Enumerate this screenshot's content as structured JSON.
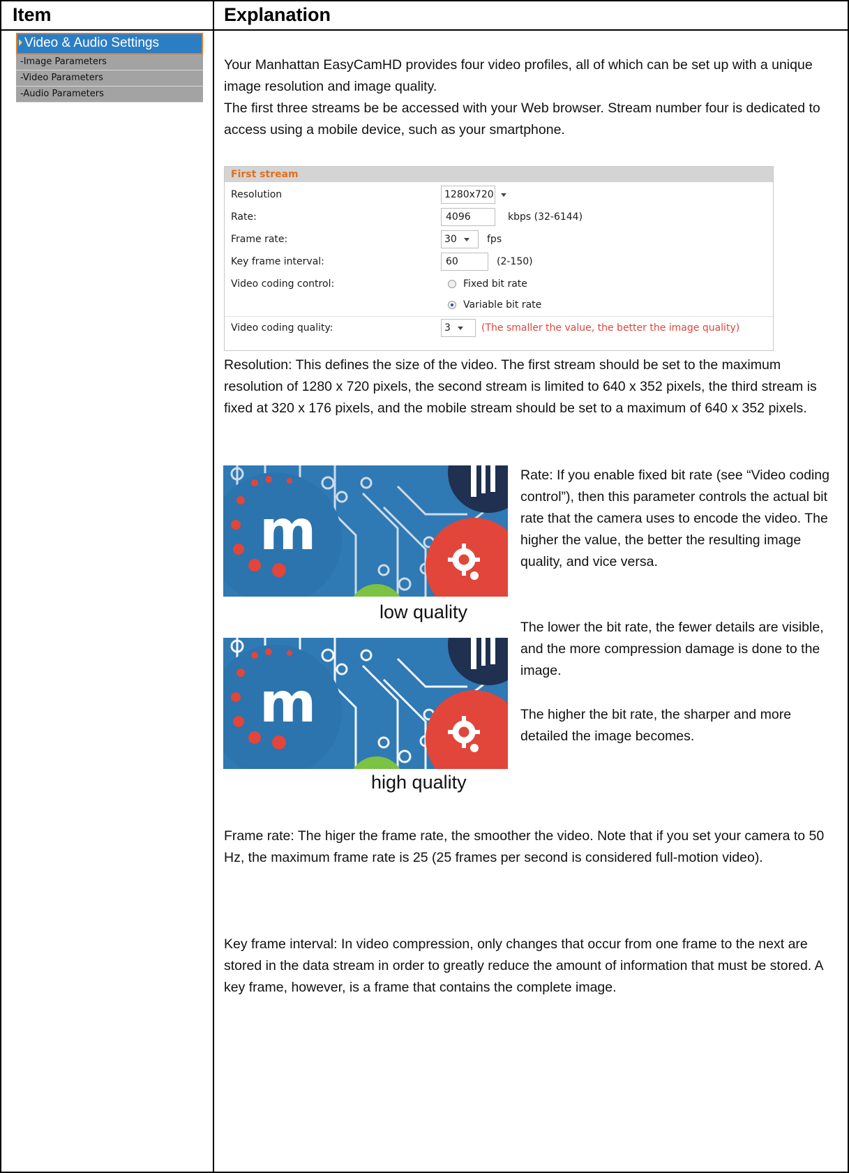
{
  "table": {
    "header_item": "Item",
    "header_explanation": "Explanation"
  },
  "menu": {
    "main": "Video & Audio Settings",
    "subs": [
      "-Image Parameters",
      "-Video Parameters",
      "-Audio Parameters"
    ]
  },
  "intro": {
    "p1": "Your Manhattan EasyCamHD provides four video profiles, all of which can be set up with a unique image resolution and image quality.",
    "p2": "The first three streams be be accessed with your Web browser. Stream number four is dedicated to access using a mobile device, such as your smartphone."
  },
  "panel": {
    "title": "First stream",
    "resolution_label": "Resolution",
    "resolution_value": "1280x720",
    "rate_label": "Rate:",
    "rate_value": "4096",
    "rate_unit": "kbps (32-6144)",
    "framerate_label": "Frame rate:",
    "framerate_value": "30",
    "framerate_unit": "fps",
    "keyframe_label": "Key frame interval:",
    "keyframe_value": "60",
    "keyframe_range": "(2-150)",
    "coding_control_label": "Video coding control:",
    "coding_fixed": "Fixed bit rate",
    "coding_variable": "Variable bit rate",
    "coding_quality_label": "Video coding quality:",
    "coding_quality_value": "3",
    "coding_quality_hint": "(The smaller the value, the better the image quality)"
  },
  "resolution_text": "Resolution: This defines the size of the video. The first stream should be set to the maximum resolution of 1280 x 720 pixels, the second stream is limited to 640 x 352 pixels, the third stream is fixed at 320 x 176 pixels, and the mobile stream should be set to a maximum of 640 x 352 pixels.",
  "rate_text": {
    "p1": "Rate: If you enable fixed bit rate (see “Video coding control”), then this parameter controls the actual bit rate that the camera uses to encode the video. The higher the value, the better the resulting image quality, and vice versa.",
    "p2": "The lower the bit rate, the fewer details are visible, and the more compression damage is done to the image.",
    "p3": "The higher the bit rate, the sharper and more detailed the image becomes."
  },
  "images": {
    "low_caption": "low quality",
    "high_caption": "high quality",
    "logo_letter": "m"
  },
  "framerate_text": "Frame rate: The higer the frame rate, the smoother the video. Note that if you set your camera to 50 Hz, the maximum frame rate is 25 (25 frames per second is considered full-motion video).",
  "keyframe_text": "Key frame interval: In video compression, only changes that occur from one frame to the next are stored in the data stream in order to greatly reduce the amount of information that must be stored. A key frame, however,  is a frame that contains the complete image.",
  "colors": {
    "menu_blue": "#2c7ec4",
    "menu_border": "#e07a2c",
    "panel_title": "#e0701e",
    "hint_red": "#e0443a",
    "image_blue": "#2f79b4",
    "image_red": "#e2453a"
  }
}
